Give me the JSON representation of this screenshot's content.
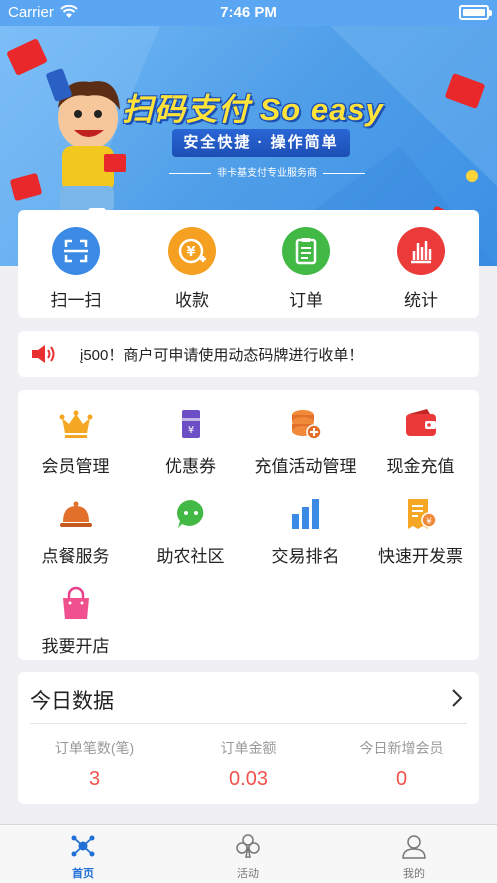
{
  "status": {
    "carrier": "Carrier",
    "time": "7:46 PM"
  },
  "banner": {
    "title": "扫码支付 So easy",
    "subtitle": "安全快捷 · 操作简单",
    "tagline": "非卡基支付专业服务商"
  },
  "quick_actions": [
    {
      "label": "扫一扫",
      "icon": "scan-icon",
      "color": "#3a8ae6"
    },
    {
      "label": "收款",
      "icon": "yuan-receive-icon",
      "color": "#f5a020"
    },
    {
      "label": "订单",
      "icon": "order-clipboard-icon",
      "color": "#42b845"
    },
    {
      "label": "统计",
      "icon": "bar-chart-icon",
      "color": "#ea3a3a"
    }
  ],
  "notice": {
    "text": "į500！商户可申请使用动态码牌进行收单！",
    "icon": "speaker-icon"
  },
  "services": [
    {
      "label": "会员管理",
      "icon": "crown-icon"
    },
    {
      "label": "优惠券",
      "icon": "coupon-icon"
    },
    {
      "label": "充值活动管理",
      "icon": "coins-icon"
    },
    {
      "label": "现金充值",
      "icon": "wallet-icon"
    },
    {
      "label": "点餐服务",
      "icon": "dish-cover-icon"
    },
    {
      "label": "助农社区",
      "icon": "chat-bubble-icon"
    },
    {
      "label": "交易排名",
      "icon": "ranking-bars-icon"
    },
    {
      "label": "快速开发票",
      "icon": "invoice-icon"
    },
    {
      "label": "我要开店",
      "icon": "shopping-bag-icon"
    }
  ],
  "today": {
    "title": "今日数据",
    "stats": [
      {
        "label": "订单笔数(笔)",
        "value": "3"
      },
      {
        "label": "订单金额",
        "value": "0.03"
      },
      {
        "label": "今日新增会员",
        "value": "0"
      }
    ]
  },
  "tabs": [
    {
      "label": "首页",
      "icon": "home-network-icon",
      "active": true
    },
    {
      "label": "活动",
      "icon": "club-icon",
      "active": false
    },
    {
      "label": "我的",
      "icon": "user-icon",
      "active": false
    }
  ],
  "colors": {
    "accent": "#1f6fd6",
    "stat_value": "#f0524a",
    "banner": "#4f9ee8"
  }
}
